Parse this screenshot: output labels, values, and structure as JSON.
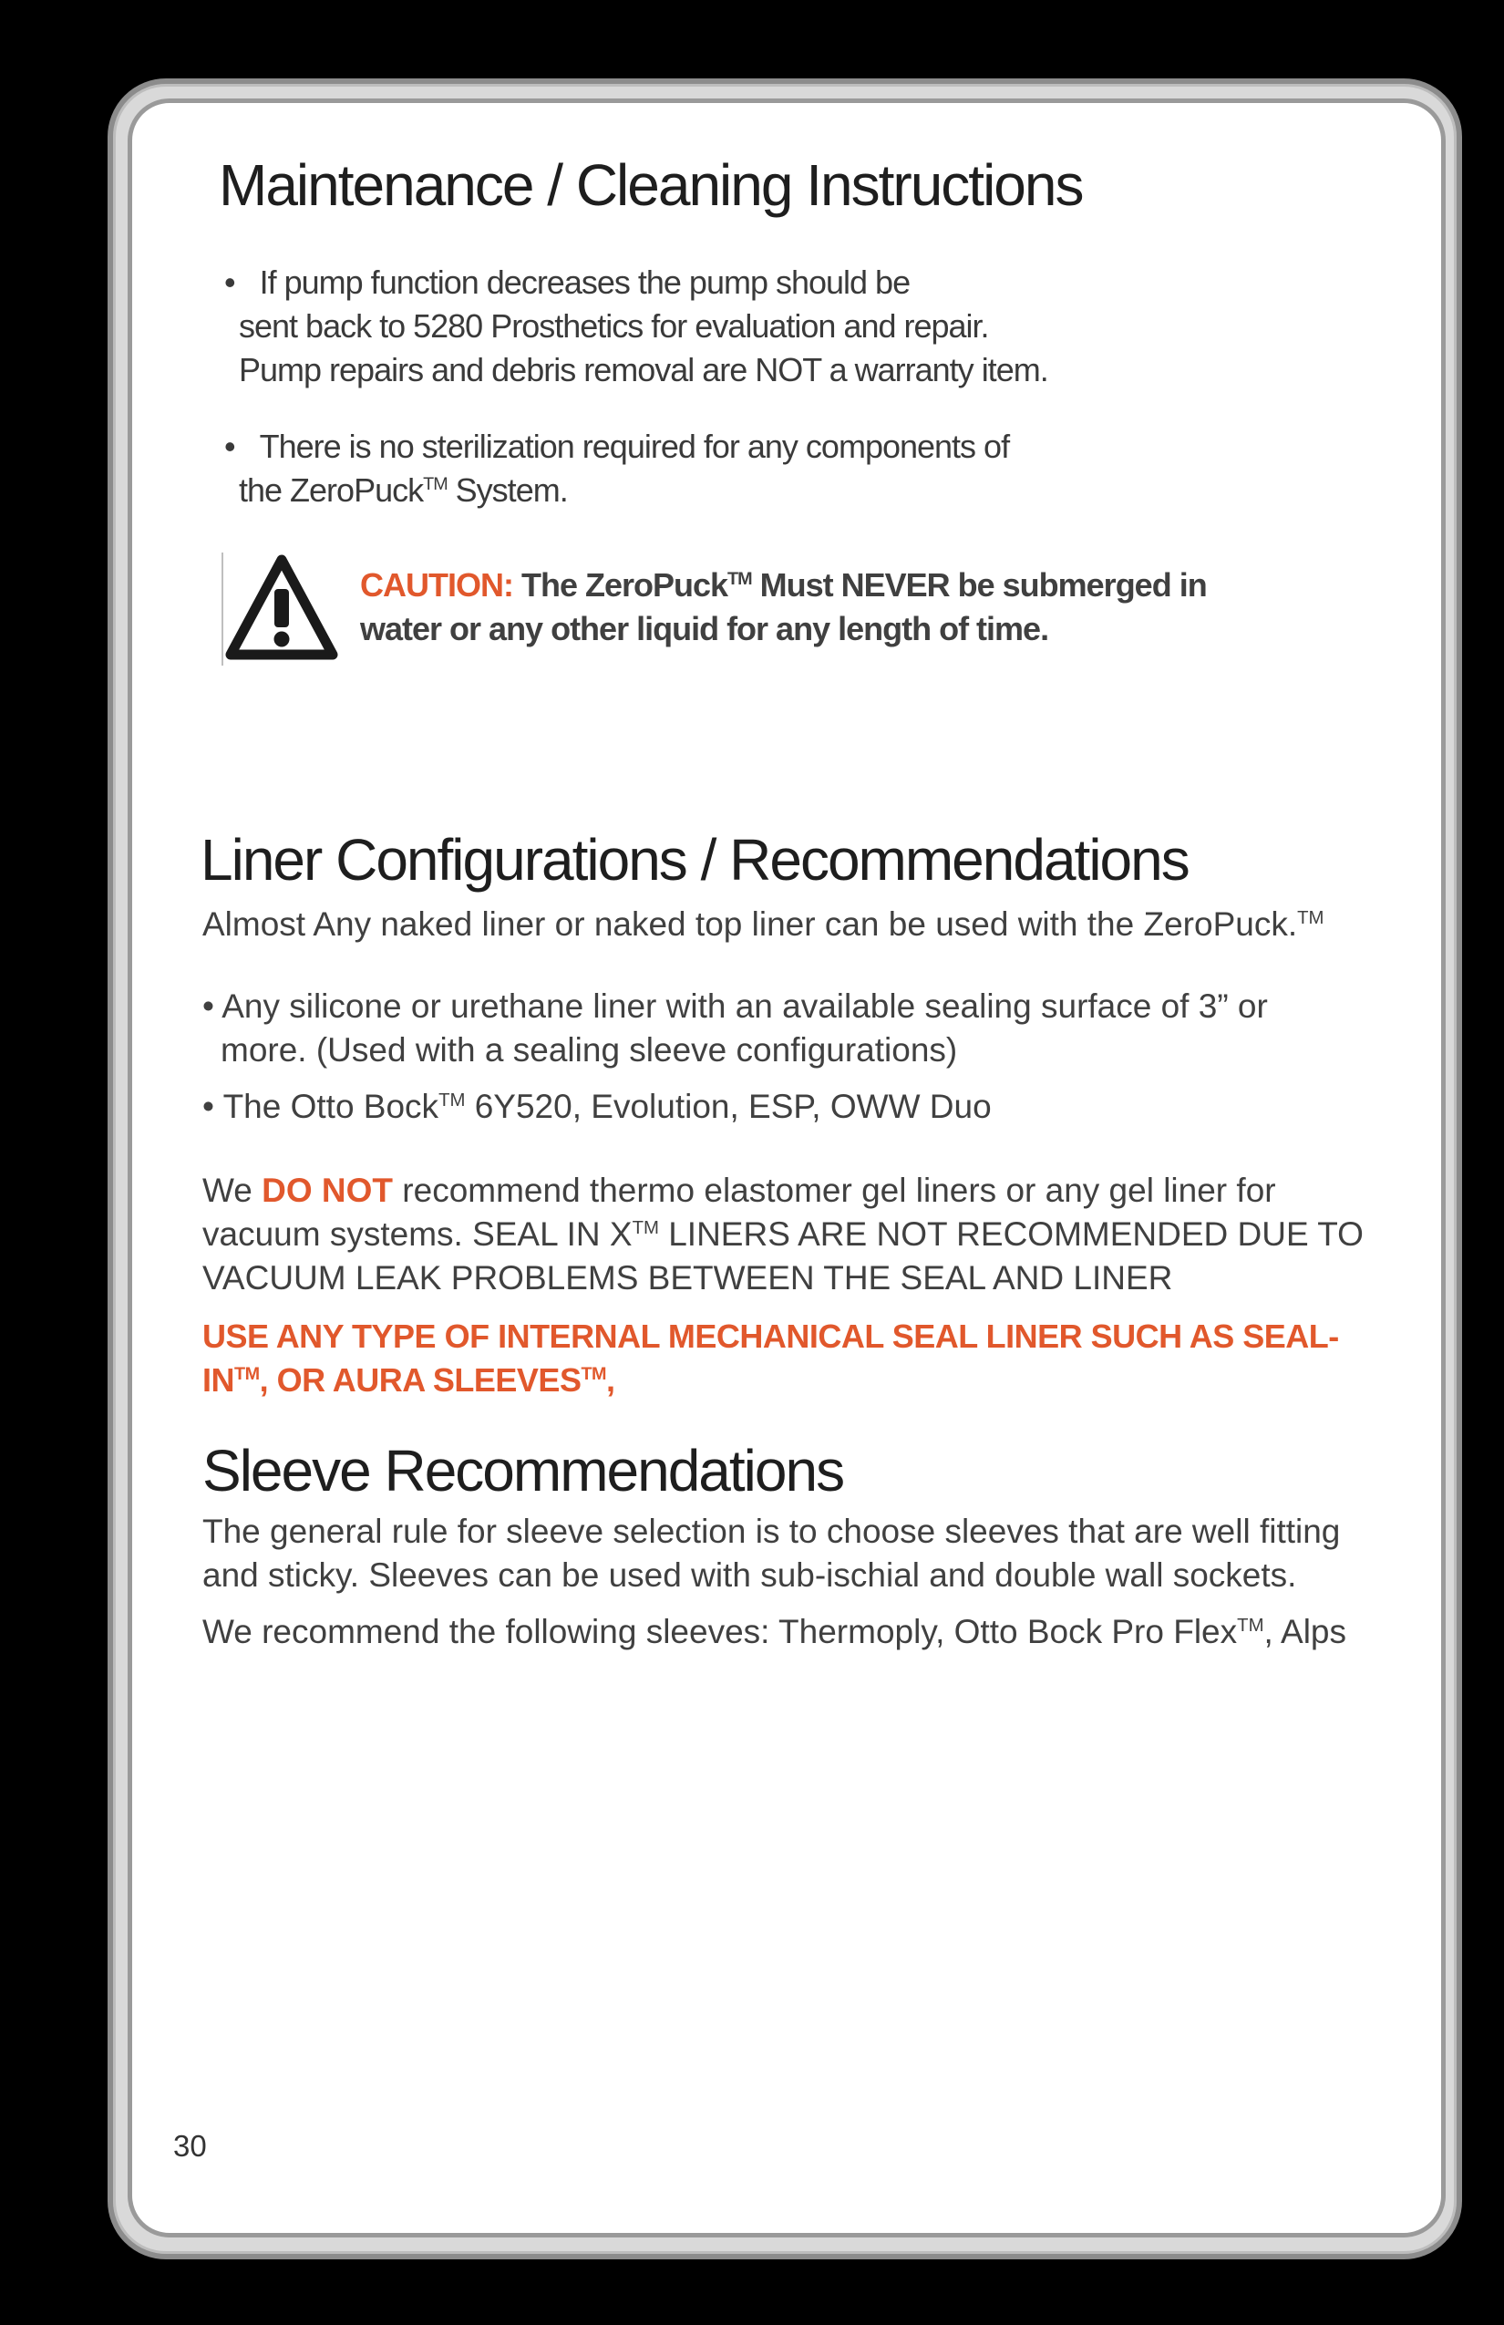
{
  "maintenance": {
    "title": "Maintenance / Cleaning Instructions",
    "bullet1": {
      "marker": "•",
      "line1": "If pump function decreases the pump should be",
      "line2": "sent back to 5280 Prosthetics for evaluation and repair.",
      "line3": "Pump repairs and debris removal are NOT a warranty item."
    },
    "bullet2": {
      "marker": "•",
      "line1": "There is no sterilization required for any components of",
      "line2_pre": "the ZeroPuck",
      "line2_tm": "TM",
      "line2_post": " System."
    },
    "caution": {
      "label": "CAUTION:",
      "line1_pre": " The ZeroPuck",
      "line1_tm": "TM",
      "line1_post": " Must NEVER be submerged in",
      "line2": "water or any other liquid for any length of time.",
      "icon": "warning-triangle-icon"
    }
  },
  "liner": {
    "title": "Liner Configurations /  Recommendations",
    "intro_pre": "Almost Any naked liner or naked top liner can be used with the ZeroPuck.",
    "intro_tm": "TM",
    "bullet1_line1": "• Any silicone or urethane liner with an available sealing surface of 3” or",
    "bullet1_line2": "more.  (Used with a sealing sleeve configurations)",
    "bullet2_pre": "• The Otto Bock",
    "bullet2_tm": "TM",
    "bullet2_post": " 6Y520, Evolution, ESP, OWW Duo",
    "warning_pre": "We ",
    "warning_em": "DO NOT",
    "warning_line1_post": " recommend thermo elastomer gel liners or any gel liner for",
    "warning_line2_pre": "vacuum systems. SEAL IN X",
    "warning_line2_tm": "TM",
    "warning_line2_post": " LINERS ARE NOT RECOMMENDED DUE TO",
    "warning_line3": "VACUUM LEAK PROBLEMS BETWEEN THE SEAL AND LINER",
    "use_line1": "USE ANY TYPE OF INTERNAL MECHANICAL SEAL LINER SUCH AS SEAL-",
    "use_line2_a": "IN",
    "use_line2_tm1": "TM",
    "use_line2_b": ", OR AURA SLEEVES",
    "use_line2_tm2": "TM",
    "use_line2_c": ","
  },
  "sleeve": {
    "title": "Sleeve Recommendations",
    "line1": "The general rule for sleeve selection is to choose sleeves that are well fitting",
    "line2": "and sticky.  Sleeves can be used with sub-ischial and double wall sockets.",
    "line3_pre": "We recommend the following sleeves:  Thermoply, Otto Bock Pro Flex",
    "line3_tm": "TM",
    "line3_post": ", Alps"
  },
  "page_number": "30",
  "colors": {
    "accent": "#e1582c",
    "text": "#3c3c3c",
    "frame": "#9a9a9a"
  }
}
